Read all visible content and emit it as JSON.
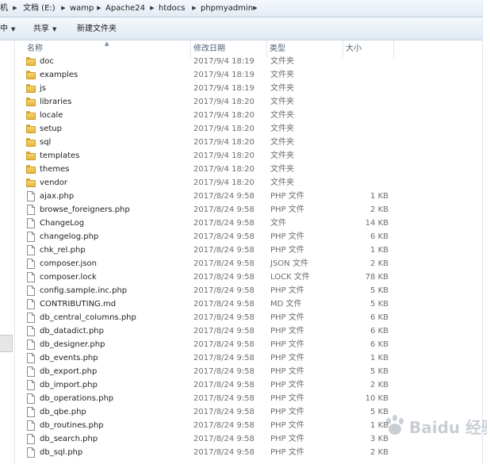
{
  "addressbar": {
    "crumbs": [
      "机",
      "文档 (E:)",
      "wamp",
      "Apache24",
      "htdocs",
      "phpmyadmin"
    ]
  },
  "toolbar": {
    "left_partial": "中",
    "share_label": "共享",
    "new_folder_label": "新建文件夹"
  },
  "columns": {
    "name": "名称",
    "date": "修改日期",
    "type": "类型",
    "size": "大小"
  },
  "files": [
    {
      "name": "doc",
      "date": "2017/9/4 18:19",
      "type": "文件夹",
      "size": "",
      "kind": "folder"
    },
    {
      "name": "examples",
      "date": "2017/9/4 18:19",
      "type": "文件夹",
      "size": "",
      "kind": "folder"
    },
    {
      "name": "js",
      "date": "2017/9/4 18:19",
      "type": "文件夹",
      "size": "",
      "kind": "folder"
    },
    {
      "name": "libraries",
      "date": "2017/9/4 18:20",
      "type": "文件夹",
      "size": "",
      "kind": "folder"
    },
    {
      "name": "locale",
      "date": "2017/9/4 18:20",
      "type": "文件夹",
      "size": "",
      "kind": "folder"
    },
    {
      "name": "setup",
      "date": "2017/9/4 18:20",
      "type": "文件夹",
      "size": "",
      "kind": "folder"
    },
    {
      "name": "sql",
      "date": "2017/9/4 18:20",
      "type": "文件夹",
      "size": "",
      "kind": "folder"
    },
    {
      "name": "templates",
      "date": "2017/9/4 18:20",
      "type": "文件夹",
      "size": "",
      "kind": "folder"
    },
    {
      "name": "themes",
      "date": "2017/9/4 18:20",
      "type": "文件夹",
      "size": "",
      "kind": "folder"
    },
    {
      "name": "vendor",
      "date": "2017/9/4 18:20",
      "type": "文件夹",
      "size": "",
      "kind": "folder"
    },
    {
      "name": "ajax.php",
      "date": "2017/8/24 9:58",
      "type": "PHP 文件",
      "size": "1 KB",
      "kind": "file"
    },
    {
      "name": "browse_foreigners.php",
      "date": "2017/8/24 9:58",
      "type": "PHP 文件",
      "size": "2 KB",
      "kind": "file"
    },
    {
      "name": "ChangeLog",
      "date": "2017/8/24 9:58",
      "type": "文件",
      "size": "14 KB",
      "kind": "file"
    },
    {
      "name": "changelog.php",
      "date": "2017/8/24 9:58",
      "type": "PHP 文件",
      "size": "6 KB",
      "kind": "file"
    },
    {
      "name": "chk_rel.php",
      "date": "2017/8/24 9:58",
      "type": "PHP 文件",
      "size": "1 KB",
      "kind": "file"
    },
    {
      "name": "composer.json",
      "date": "2017/8/24 9:58",
      "type": "JSON 文件",
      "size": "2 KB",
      "kind": "file"
    },
    {
      "name": "composer.lock",
      "date": "2017/8/24 9:58",
      "type": "LOCK 文件",
      "size": "78 KB",
      "kind": "file"
    },
    {
      "name": "config.sample.inc.php",
      "date": "2017/8/24 9:58",
      "type": "PHP 文件",
      "size": "5 KB",
      "kind": "file"
    },
    {
      "name": "CONTRIBUTING.md",
      "date": "2017/8/24 9:58",
      "type": "MD 文件",
      "size": "5 KB",
      "kind": "file"
    },
    {
      "name": "db_central_columns.php",
      "date": "2017/8/24 9:58",
      "type": "PHP 文件",
      "size": "6 KB",
      "kind": "file"
    },
    {
      "name": "db_datadict.php",
      "date": "2017/8/24 9:58",
      "type": "PHP 文件",
      "size": "6 KB",
      "kind": "file"
    },
    {
      "name": "db_designer.php",
      "date": "2017/8/24 9:58",
      "type": "PHP 文件",
      "size": "6 KB",
      "kind": "file"
    },
    {
      "name": "db_events.php",
      "date": "2017/8/24 9:58",
      "type": "PHP 文件",
      "size": "1 KB",
      "kind": "file"
    },
    {
      "name": "db_export.php",
      "date": "2017/8/24 9:58",
      "type": "PHP 文件",
      "size": "5 KB",
      "kind": "file"
    },
    {
      "name": "db_import.php",
      "date": "2017/8/24 9:58",
      "type": "PHP 文件",
      "size": "2 KB",
      "kind": "file"
    },
    {
      "name": "db_operations.php",
      "date": "2017/8/24 9:58",
      "type": "PHP 文件",
      "size": "10 KB",
      "kind": "file"
    },
    {
      "name": "db_qbe.php",
      "date": "2017/8/24 9:58",
      "type": "PHP 文件",
      "size": "5 KB",
      "kind": "file"
    },
    {
      "name": "db_routines.php",
      "date": "2017/8/24 9:58",
      "type": "PHP 文件",
      "size": "1 KB",
      "kind": "file"
    },
    {
      "name": "db_search.php",
      "date": "2017/8/24 9:58",
      "type": "PHP 文件",
      "size": "3 KB",
      "kind": "file"
    },
    {
      "name": "db_sql.php",
      "date": "2017/8/24 9:58",
      "type": "PHP 文件",
      "size": "2 KB",
      "kind": "file"
    }
  ],
  "watermark": {
    "text": "Baidu 经验"
  }
}
